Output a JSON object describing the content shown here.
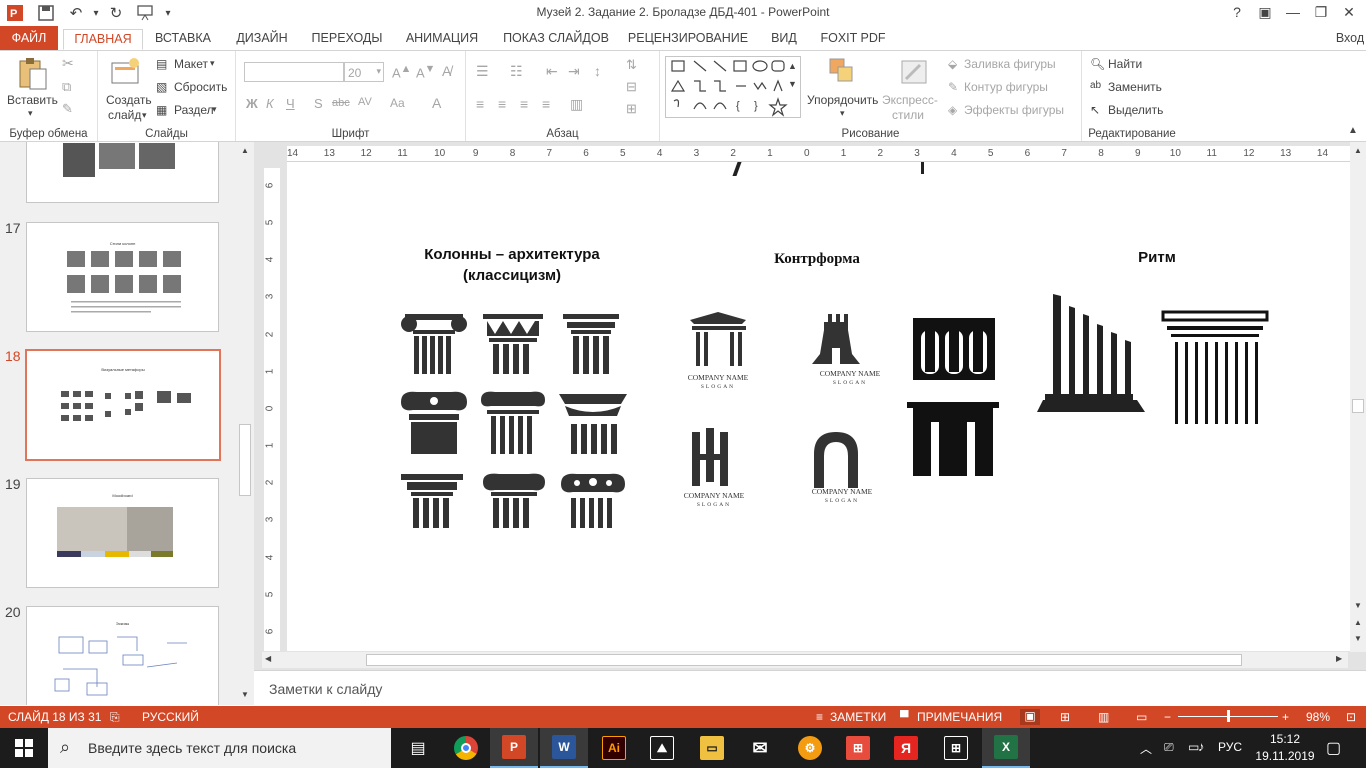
{
  "window": {
    "title": "Музей 2. Задание 2. Броладзе ДБД-401 - PowerPoint",
    "help": "?",
    "signin": "Вход"
  },
  "tabs": [
    {
      "label": "ФАЙЛ"
    },
    {
      "label": "ГЛАВНАЯ"
    },
    {
      "label": "ВСТАВКА"
    },
    {
      "label": "ДИЗАЙН"
    },
    {
      "label": "ПЕРЕХОДЫ"
    },
    {
      "label": "АНИМАЦИЯ"
    },
    {
      "label": "ПОКАЗ СЛАЙДОВ"
    },
    {
      "label": "РЕЦЕНЗИРОВАНИЕ"
    },
    {
      "label": "ВИД"
    },
    {
      "label": "FOXIT PDF"
    }
  ],
  "ribbon": {
    "clipboard": {
      "paste": "Вставить",
      "label": "Буфер обмена"
    },
    "slides": {
      "new1": "Создать",
      "new2": "слайд",
      "layout": "Макет",
      "reset": "Сбросить",
      "section": "Раздел",
      "label": "Слайды"
    },
    "font": {
      "size": "20",
      "label": "Шрифт",
      "bold": "Ж",
      "italic": "К",
      "underline": "Ч",
      "shadow": "S",
      "strike": "abc",
      "spacing": "AV",
      "case": "Aa"
    },
    "paragraph": {
      "label": "Абзац"
    },
    "drawing": {
      "arrange": "Упорядочить",
      "quick1": "Экспресс-",
      "quick2": "стили",
      "fill": "Заливка фигуры",
      "outline": "Контур фигуры",
      "effects": "Эффекты фигуры",
      "label": "Рисование"
    },
    "editing": {
      "find": "Найти",
      "replace": "Заменить",
      "select": "Выделить",
      "label": "Редактирование"
    }
  },
  "thumbnails": [
    {
      "num": "",
      "title": ""
    },
    {
      "num": "17",
      "title": "Стили колонн"
    },
    {
      "num": "18",
      "title": "Визуальные метафоры"
    },
    {
      "num": "19",
      "title": "Moodboard"
    },
    {
      "num": "20",
      "title": "Эскизы"
    }
  ],
  "ruler": {
    "h": [
      "14",
      "13",
      "12",
      "11",
      "10",
      "9",
      "8",
      "7",
      "6",
      "5",
      "4",
      "3",
      "2",
      "1",
      "0",
      "1",
      "2",
      "3",
      "4",
      "5",
      "6",
      "7",
      "8",
      "9",
      "10",
      "11",
      "12",
      "13",
      "14"
    ],
    "v": [
      "6",
      "5",
      "4",
      "3",
      "2",
      "1",
      "0",
      "1",
      "2",
      "3",
      "4",
      "5",
      "6"
    ]
  },
  "slide": {
    "col1_title_1": "Колонны – архитектура",
    "col1_title_2": "(классицизм)",
    "col2_title": "Контрформа",
    "col3_title": "Ритм",
    "logo_text": "COMPANY NAME",
    "logo_slogan": "SLOGAN"
  },
  "notes": {
    "placeholder": "Заметки к слайду"
  },
  "status": {
    "slide_info": "СЛАЙД 18 ИЗ 31",
    "language": "РУССКИЙ",
    "notes": "ЗАМЕТКИ",
    "comments": "ПРИМЕЧАНИЯ",
    "zoom": "98%",
    "zoom_level": 0.5
  },
  "taskbar": {
    "search_placeholder": "Введите здесь текст для поиска",
    "lang": "РУС",
    "time": "15:12",
    "date": "19.11.2019"
  },
  "colors": {
    "accent": "#d24726",
    "taskbar": "#1c1c1c"
  }
}
